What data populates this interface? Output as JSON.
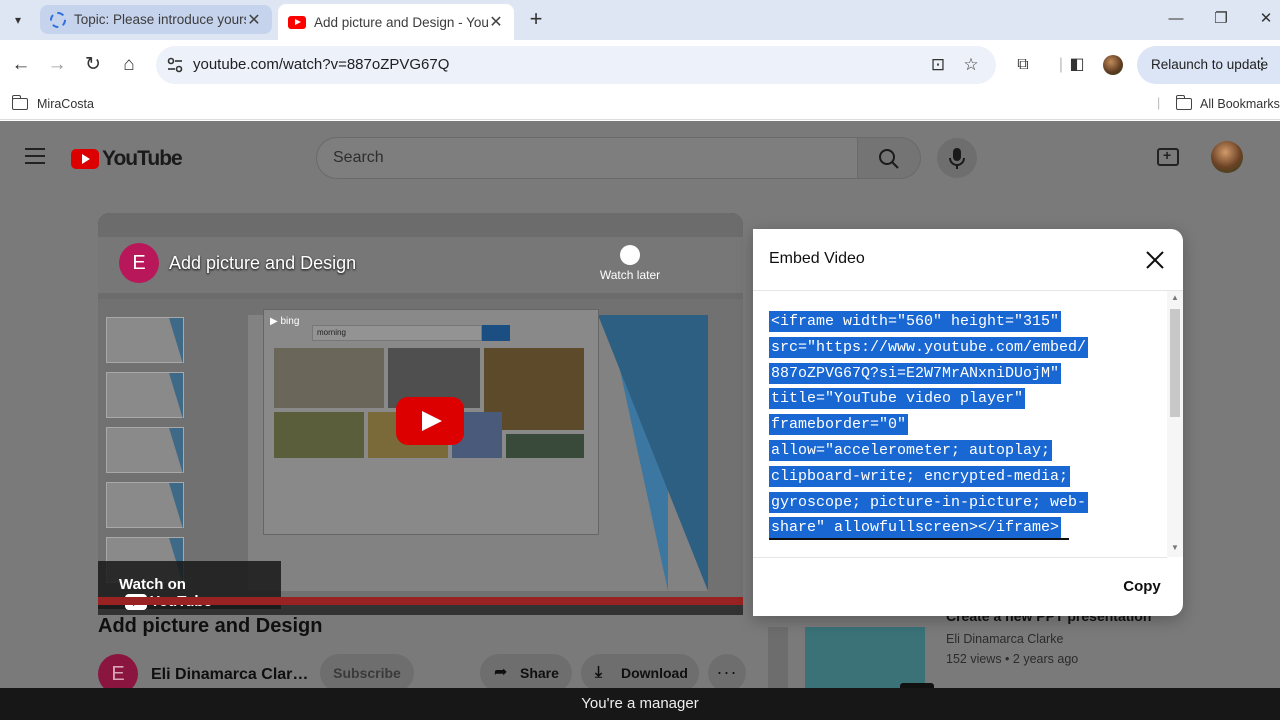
{
  "browser": {
    "tabs": [
      {
        "label": "Topic: Please introduce yourself",
        "active": false
      },
      {
        "label": "Add picture and Design - YouTube",
        "active": true
      }
    ],
    "url": "youtube.com/watch?v=887oZPVG67Q",
    "relaunch_label": "Relaunch to update",
    "bookmarks": {
      "left": "MiraCosta",
      "right": "All Bookmarks"
    }
  },
  "youtube": {
    "logo_text": "YouTube",
    "search_placeholder": "Search",
    "video": {
      "overlay_avatar_letter": "E",
      "overlay_title": "Add picture and Design",
      "watch_later": "Watch later",
      "share": "Share",
      "watch_on": "Watch on",
      "watch_on_brand": "YouTube",
      "bing_query": "morning"
    },
    "title": "Add picture and Design",
    "channel": {
      "avatar_letter": "E",
      "name": "Eli Dinamarca Clar…"
    },
    "subscribe_label": "Subscribe",
    "share_label": "Share",
    "download_label": "Download",
    "sidebar_item": {
      "title": "Create a new PPT presentation",
      "channel": "Eli Dinamarca Clarke",
      "meta": "152 views • 2 years ago"
    }
  },
  "embed_dialog": {
    "title": "Embed Video",
    "code_lines": [
      "<iframe width=\"560\" height=\"315\"",
      "src=\"https://www.youtube.com/embed/",
      "887oZPVG67Q?si=E2W7MrANxniDUojM\"",
      "title=\"YouTube video player\"",
      "frameborder=\"0\"",
      "allow=\"accelerometer; autoplay;",
      "clipboard-write; encrypted-media;",
      "gyroscope; picture-in-picture; web-",
      "share\" allowfullscreen></iframe>"
    ],
    "copy_label": "Copy"
  },
  "toast": "You're a manager",
  "colors": {
    "selection": "#1967d2",
    "youtube_red": "#ff0000",
    "tab_bar": "#dfe6f3"
  }
}
